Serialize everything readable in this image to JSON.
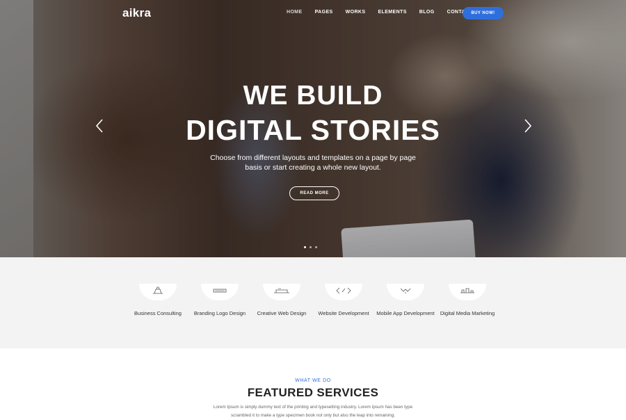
{
  "header": {
    "logo": "aikra",
    "menu": [
      {
        "label": "HOME"
      },
      {
        "label": "PAGES"
      },
      {
        "label": "WORKS"
      },
      {
        "label": "ELEMENTS"
      },
      {
        "label": "BLOG"
      },
      {
        "label": "CONTACT"
      }
    ],
    "cta_label": "BUY NOW!",
    "accent_color": "#2f6fdc"
  },
  "hero": {
    "title_line1": "WE BUILD",
    "title_line2": "DIGITAL STORIES",
    "subtitle": "Choose from different layouts and templates on a page by page basis or start creating a whole new layout.",
    "button_label": "READ MORE",
    "slides": 3,
    "active_slide": 1
  },
  "services": [
    {
      "label": "Business Consulting",
      "icon": "briefcase-icon"
    },
    {
      "label": "Branding Logo Design",
      "icon": "pen-icon"
    },
    {
      "label": "Creative Web Design",
      "icon": "laptop-icon"
    },
    {
      "label": "Website Development",
      "icon": "code-icon"
    },
    {
      "label": "Mobile App Development",
      "icon": "mobile-icon"
    },
    {
      "label": "Digital Media Marketing",
      "icon": "megaphone-icon"
    }
  ],
  "featured": {
    "kicker": "WHAT WE DO",
    "title": "FEATURED SERVICES",
    "text": "Lorem Ipsum is simply dummy text of the printing and typesetting industry. Lorem Ipsum has been type scrambled it to make a type specimen book not only but also the leap into remaining."
  }
}
